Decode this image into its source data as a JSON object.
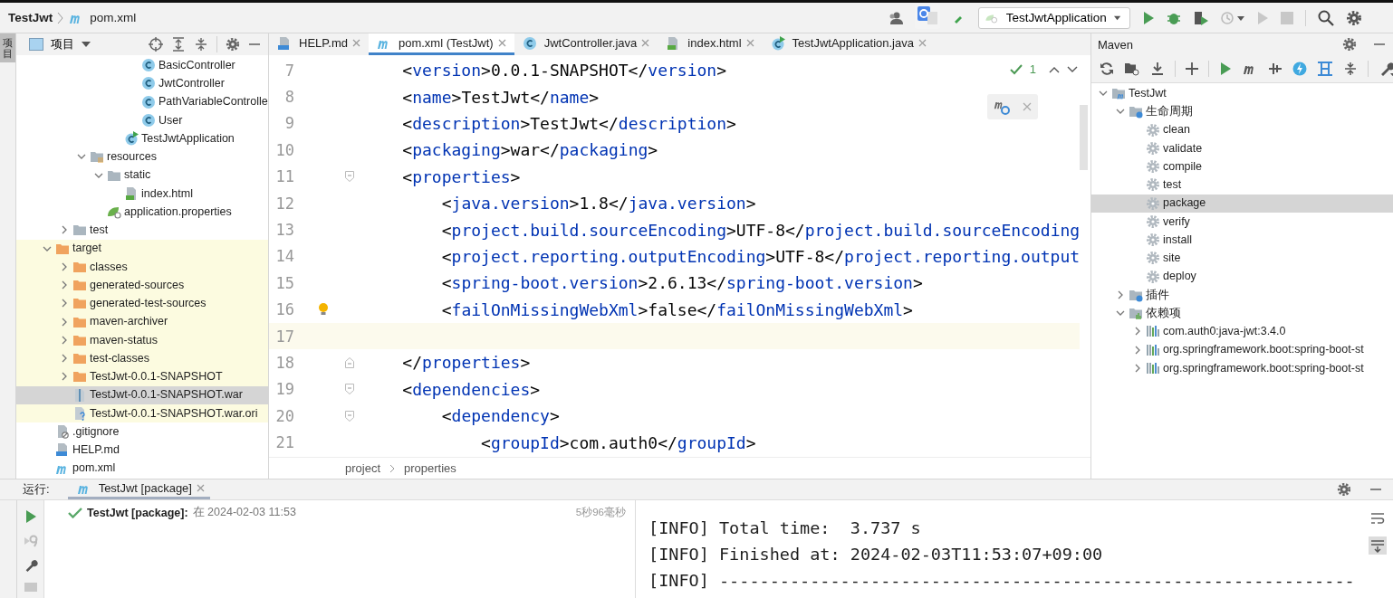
{
  "title_bar": {
    "breadcrumb": [
      {
        "label": "TestJwt",
        "kind": "project"
      },
      {
        "label": "pom.xml",
        "kind": "maven"
      }
    ],
    "run_config": "TestJwtApplication"
  },
  "left_stripe": {
    "tab": "项目"
  },
  "project": {
    "view": "项目",
    "items": [
      {
        "children": [
          {
            "children": [
              {
                "children": [
                  {
                    "children": [
                      {
                        "children": [
                          {
                            "label": "BasicController",
                            "kind": "class",
                            "excluded": false,
                            "selected": false
                          },
                          {
                            "label": "JwtController",
                            "kind": "class",
                            "excluded": false,
                            "selected": false
                          },
                          {
                            "label": "PathVariableControlle",
                            "kind": "class",
                            "excluded": false,
                            "selected": false
                          },
                          {
                            "label": "User",
                            "kind": "class",
                            "excluded": false,
                            "selected": false
                          }
                        ]
                      },
                      {
                        "label": "TestJwtApplication",
                        "kind": "spring-class",
                        "excluded": false,
                        "selected": false
                      }
                    ]
                  }
                ]
              },
              {
                "label": "resources",
                "kind": "resource-folder",
                "expanded": true,
                "excluded": false,
                "selected": false,
                "children": [
                  {
                    "label": "static",
                    "kind": "folder",
                    "expanded": true,
                    "excluded": false,
                    "selected": false,
                    "children": [
                      {
                        "label": "index.html",
                        "kind": "html",
                        "excluded": false,
                        "selected": false
                      }
                    ]
                  },
                  {
                    "label": "application.properties",
                    "kind": "spring-properties",
                    "excluded": false,
                    "selected": false
                  }
                ]
              }
            ]
          },
          {
            "label": "test",
            "kind": "folder",
            "expanded": false,
            "excluded": false,
            "selected": false
          }
        ]
      },
      {
        "label": "target",
        "kind": "orange-folder",
        "expanded": true,
        "excluded": true,
        "selected": false,
        "children": [
          {
            "label": "classes",
            "kind": "orange-folder",
            "expanded": false,
            "excluded": true,
            "selected": false
          },
          {
            "label": "generated-sources",
            "kind": "orange-folder",
            "expanded": false,
            "excluded": true,
            "selected": false
          },
          {
            "label": "generated-test-sources",
            "kind": "orange-folder",
            "expanded": false,
            "excluded": true,
            "selected": false
          },
          {
            "label": "maven-archiver",
            "kind": "orange-folder",
            "expanded": false,
            "excluded": true,
            "selected": false
          },
          {
            "label": "maven-status",
            "kind": "orange-folder",
            "expanded": false,
            "excluded": true,
            "selected": false
          },
          {
            "label": "test-classes",
            "kind": "orange-folder",
            "expanded": false,
            "excluded": true,
            "selected": false
          },
          {
            "label": "TestJwt-0.0.1-SNAPSHOT",
            "kind": "orange-folder",
            "expanded": false,
            "excluded": true,
            "selected": false
          },
          {
            "label": "TestJwt-0.0.1-SNAPSHOT.war",
            "kind": "archive",
            "excluded": true,
            "selected": true
          },
          {
            "label": "TestJwt-0.0.1-SNAPSHOT.war.ori",
            "kind": "unknown",
            "excluded": true,
            "selected": false
          }
        ]
      },
      {
        "label": ".gitignore",
        "kind": "gitignore",
        "excluded": false,
        "selected": false
      },
      {
        "label": "HELP.md",
        "kind": "md",
        "excluded": false,
        "selected": false
      },
      {
        "label": "pom.xml",
        "kind": "maven",
        "excluded": false,
        "selected": false
      }
    ]
  },
  "editor": {
    "tabs": [
      {
        "label": "HELP.md",
        "kind": "md",
        "selected": false
      },
      {
        "label": "pom.xml (TestJwt)",
        "kind": "maven",
        "selected": true
      },
      {
        "label": "JwtController.java",
        "kind": "class",
        "selected": false
      },
      {
        "label": "index.html",
        "kind": "html",
        "selected": false
      },
      {
        "label": "TestJwtApplication.java",
        "kind": "spring-class",
        "selected": false
      }
    ],
    "inspection_count": "1",
    "lines": [
      {
        "number": "7",
        "current": false,
        "bulb": false,
        "tokens": [
          {
            "kind": "punct",
            "text": "    <"
          },
          {
            "kind": "tag",
            "text": "version"
          },
          {
            "kind": "punct",
            "text": ">"
          },
          {
            "kind": "value",
            "text": "0.0.1-SNAPSHOT"
          },
          {
            "kind": "punct",
            "text": "</"
          },
          {
            "kind": "tag",
            "text": "version"
          },
          {
            "kind": "punct",
            "text": ">"
          }
        ]
      },
      {
        "number": "8",
        "current": false,
        "bulb": false,
        "tokens": [
          {
            "kind": "punct",
            "text": "    <"
          },
          {
            "kind": "tag",
            "text": "name"
          },
          {
            "kind": "punct",
            "text": ">"
          },
          {
            "kind": "value",
            "text": "TestJwt"
          },
          {
            "kind": "punct",
            "text": "</"
          },
          {
            "kind": "tag",
            "text": "name"
          },
          {
            "kind": "punct",
            "text": ">"
          }
        ]
      },
      {
        "number": "9",
        "current": false,
        "bulb": false,
        "tokens": [
          {
            "kind": "punct",
            "text": "    <"
          },
          {
            "kind": "tag",
            "text": "description"
          },
          {
            "kind": "punct",
            "text": ">"
          },
          {
            "kind": "value",
            "text": "TestJwt"
          },
          {
            "kind": "punct",
            "text": "</"
          },
          {
            "kind": "tag",
            "text": "description"
          },
          {
            "kind": "punct",
            "text": ">"
          }
        ]
      },
      {
        "number": "10",
        "current": false,
        "bulb": false,
        "tokens": [
          {
            "kind": "punct",
            "text": "    <"
          },
          {
            "kind": "tag",
            "text": "packaging"
          },
          {
            "kind": "punct",
            "text": ">"
          },
          {
            "kind": "value",
            "text": "war"
          },
          {
            "kind": "punct",
            "text": "</"
          },
          {
            "kind": "tag",
            "text": "packaging"
          },
          {
            "kind": "punct",
            "text": ">"
          }
        ]
      },
      {
        "number": "11",
        "current": false,
        "bulb": false,
        "kind": "fold-start",
        "tokens": [
          {
            "kind": "punct",
            "text": "    <"
          },
          {
            "kind": "tag",
            "text": "properties"
          },
          {
            "kind": "punct",
            "text": ">"
          }
        ]
      },
      {
        "number": "12",
        "current": false,
        "bulb": false,
        "tokens": [
          {
            "kind": "punct",
            "text": "        <"
          },
          {
            "kind": "tag",
            "text": "java.version"
          },
          {
            "kind": "punct",
            "text": ">"
          },
          {
            "kind": "value",
            "text": "1.8"
          },
          {
            "kind": "punct",
            "text": "</"
          },
          {
            "kind": "tag",
            "text": "java.version"
          },
          {
            "kind": "punct",
            "text": ">"
          }
        ]
      },
      {
        "number": "13",
        "current": false,
        "bulb": false,
        "tokens": [
          {
            "kind": "punct",
            "text": "        <"
          },
          {
            "kind": "tag",
            "text": "project.build.sourceEncoding"
          },
          {
            "kind": "punct",
            "text": ">"
          },
          {
            "kind": "value",
            "text": "UTF-8"
          },
          {
            "kind": "punct",
            "text": "</"
          },
          {
            "kind": "tag",
            "text": "project.build.sourceEncoding"
          }
        ]
      },
      {
        "number": "14",
        "current": false,
        "bulb": false,
        "tokens": [
          {
            "kind": "punct",
            "text": "        <"
          },
          {
            "kind": "tag",
            "text": "project.reporting.outputEncoding"
          },
          {
            "kind": "punct",
            "text": ">"
          },
          {
            "kind": "value",
            "text": "UTF-8"
          },
          {
            "kind": "punct",
            "text": "</"
          },
          {
            "kind": "tag",
            "text": "project.reporting.output"
          }
        ]
      },
      {
        "number": "15",
        "current": false,
        "bulb": false,
        "tokens": [
          {
            "kind": "punct",
            "text": "        <"
          },
          {
            "kind": "tag",
            "text": "spring-boot.version"
          },
          {
            "kind": "punct",
            "text": ">"
          },
          {
            "kind": "value",
            "text": "2.6.13"
          },
          {
            "kind": "punct",
            "text": "</"
          },
          {
            "kind": "tag",
            "text": "spring-boot.version"
          },
          {
            "kind": "punct",
            "text": ">"
          }
        ]
      },
      {
        "number": "16",
        "current": false,
        "bulb": true,
        "tokens": [
          {
            "kind": "punct",
            "text": "        <"
          },
          {
            "kind": "tag",
            "text": "failOnMissingWebXml"
          },
          {
            "kind": "punct",
            "text": ">"
          },
          {
            "kind": "value",
            "text": "false"
          },
          {
            "kind": "punct",
            "text": "</"
          },
          {
            "kind": "tag",
            "text": "failOnMissingWebXml"
          },
          {
            "kind": "punct",
            "text": ">"
          }
        ]
      },
      {
        "number": "17",
        "current": true,
        "bulb": false
      },
      {
        "number": "18",
        "current": false,
        "bulb": false,
        "kind": "fold-end",
        "tokens": [
          {
            "kind": "punct",
            "text": "    </"
          },
          {
            "kind": "tag",
            "text": "properties"
          },
          {
            "kind": "punct",
            "text": ">"
          }
        ]
      },
      {
        "number": "19",
        "current": false,
        "bulb": false,
        "kind": "fold-start",
        "tokens": [
          {
            "kind": "punct",
            "text": "    <"
          },
          {
            "kind": "tag",
            "text": "dependencies"
          },
          {
            "kind": "punct",
            "text": ">"
          }
        ]
      },
      {
        "number": "20",
        "current": false,
        "bulb": false,
        "kind": "fold-start",
        "tokens": [
          {
            "kind": "punct",
            "text": "        <"
          },
          {
            "kind": "tag",
            "text": "dependency"
          },
          {
            "kind": "punct",
            "text": ">"
          }
        ]
      },
      {
        "number": "21",
        "current": false,
        "bulb": false,
        "tokens": [
          {
            "kind": "punct",
            "text": "            <"
          },
          {
            "kind": "tag",
            "text": "groupId"
          },
          {
            "kind": "punct",
            "text": ">"
          },
          {
            "kind": "value",
            "text": "com.auth0"
          },
          {
            "kind": "punct",
            "text": "</"
          },
          {
            "kind": "tag",
            "text": "groupId"
          },
          {
            "kind": "punct",
            "text": ">"
          }
        ]
      }
    ],
    "breadcrumb": [
      "project",
      "properties"
    ]
  },
  "maven": {
    "title": "Maven",
    "items": [
      {
        "label": "TestJwt",
        "kind": "maven-project",
        "expanded": true,
        "selected": false,
        "children": [
          {
            "label": "生命周期",
            "kind": "lifecycle",
            "expanded": true,
            "selected": false,
            "children": [
              {
                "label": "clean",
                "kind": "gear",
                "selected": false
              },
              {
                "label": "validate",
                "kind": "gear",
                "selected": false
              },
              {
                "label": "compile",
                "kind": "gear",
                "selected": false
              },
              {
                "label": "test",
                "kind": "gear",
                "selected": false
              },
              {
                "label": "package",
                "kind": "gear",
                "selected": true
              },
              {
                "label": "verify",
                "kind": "gear",
                "selected": false
              },
              {
                "label": "install",
                "kind": "gear",
                "selected": false
              },
              {
                "label": "site",
                "kind": "gear",
                "selected": false
              },
              {
                "label": "deploy",
                "kind": "gear",
                "selected": false
              }
            ]
          },
          {
            "label": "插件",
            "kind": "lifecycle",
            "expanded": false,
            "selected": false
          },
          {
            "label": "依赖项",
            "kind": "deps",
            "expanded": true,
            "selected": false,
            "children": [
              {
                "label": "com.auth0:java-jwt:3.4.0",
                "kind": "dependency",
                "expanded": false,
                "selected": false
              },
              {
                "label": "org.springframework.boot:spring-boot-st",
                "kind": "dependency",
                "expanded": false,
                "selected": false
              },
              {
                "label": "org.springframework.boot:spring-boot-st",
                "kind": "dependency",
                "expanded": false,
                "selected": false
              }
            ]
          }
        ]
      }
    ]
  },
  "run": {
    "label": "运行:",
    "tab": "TestJwt [package]",
    "task": {
      "name": "TestJwt [package]:",
      "time": "在 2024-02-03 11:53",
      "duration": "5秒96毫秒",
      "succeeded": true
    },
    "console": [
      "[INFO] Total time:  3.737 s",
      "[INFO] Finished at: 2024-02-03T11:53:07+09:00",
      "[INFO] ---------------------------------------------------------------"
    ]
  }
}
